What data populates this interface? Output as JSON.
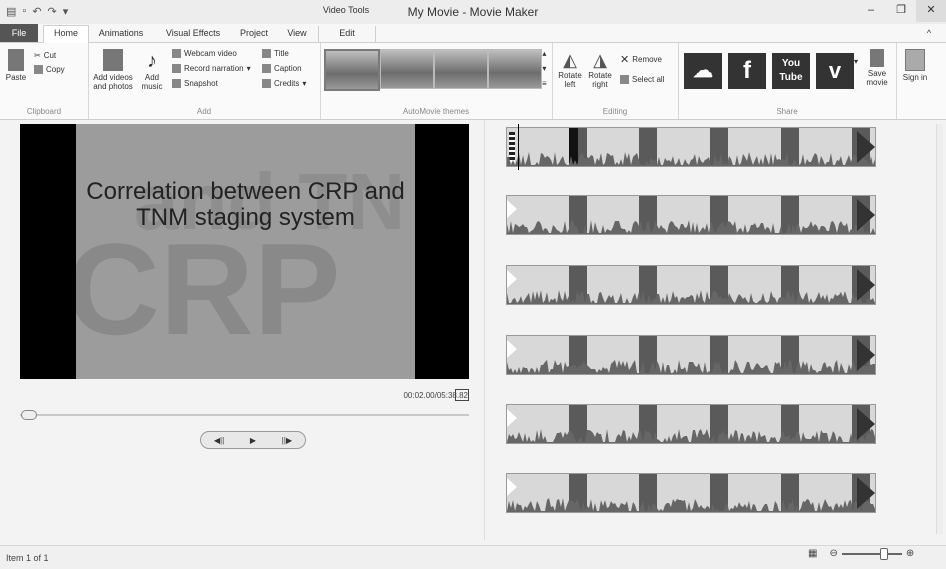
{
  "window": {
    "title": "My Movie - Movie Maker",
    "context_tab_title": "Video Tools",
    "controls": [
      "–",
      "❐",
      "✕"
    ]
  },
  "tabs": [
    "File",
    "Home",
    "Animations",
    "Visual Effects",
    "Project",
    "View",
    "Edit"
  ],
  "ribbon": {
    "clipboard": {
      "paste": "Paste",
      "cut": "Cut",
      "copy": "Copy",
      "label": "Clipboard"
    },
    "add": {
      "add_videos": "Add videos and photos",
      "add_music": "Add music",
      "webcam": "Webcam video",
      "narration": "Record narration",
      "snapshot": "Snapshot",
      "title": "Title",
      "caption": "Caption",
      "credits": "Credits",
      "label": "Add"
    },
    "themes": {
      "label": "AutoMovie themes"
    },
    "editing": {
      "rotate_left": "Rotate left",
      "rotate_right": "Rotate right",
      "remove": "Remove",
      "select_all": "Select all",
      "label": "Editing"
    },
    "share": {
      "label": "Share",
      "save_movie": "Save movie",
      "sign_in": "Sign in",
      "services": [
        {
          "name": "onedrive-icon",
          "glyph": "☁"
        },
        {
          "name": "facebook-icon",
          "glyph": "f"
        },
        {
          "name": "youtube-icon",
          "glyph": "You Tube"
        },
        {
          "name": "vimeo-icon",
          "glyph": "v"
        }
      ]
    }
  },
  "preview": {
    "slide_title": "Correlation between CRP and TNM staging system",
    "bg_words": [
      "and TN",
      "CRP"
    ],
    "timecode": "00:02.00/05:38.82",
    "controls": [
      "◀||",
      "▶",
      "||▶"
    ]
  },
  "statusbar": {
    "text": "Item 1 of 1"
  }
}
